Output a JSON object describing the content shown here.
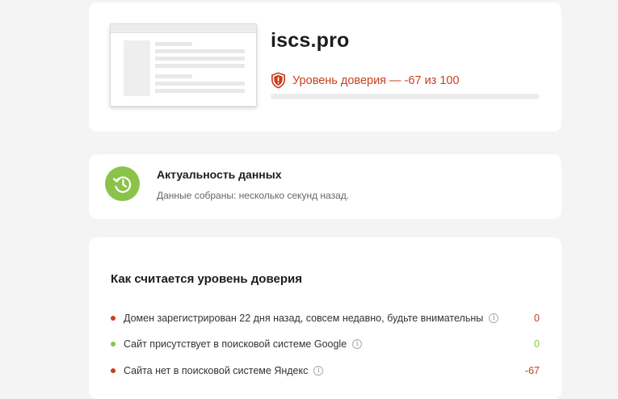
{
  "site": {
    "domain": "iscs.pro",
    "trust_text": "Уровень доверия — -67 из 100",
    "trust_score": -67,
    "trust_max": 100,
    "trust_fill_percent": 0,
    "trust_color": "#c6401f"
  },
  "freshness": {
    "title": "Актуальность данных",
    "description": "Данные собраны: несколько секунд назад.",
    "icon": "clock-refresh-icon",
    "icon_bg": "#8bc34a"
  },
  "score": {
    "title": "Как считается уровень доверия",
    "factors": [
      {
        "text": "Домен зарегистрирован 22 дня назад, совсем недавно, будьте внимательны",
        "points": "0",
        "dot_color": "#c6401f",
        "points_color": "#c6401f"
      },
      {
        "text": "Сайт присутствует в поисковой системе Google",
        "points": "0",
        "dot_color": "#8bc34a",
        "points_color": "#8bc34a"
      },
      {
        "text": "Сайта нет в поисковой системе Яндекс",
        "points": "-67",
        "dot_color": "#c6401f",
        "points_color": "#c6401f"
      }
    ],
    "info_glyph": "i"
  }
}
